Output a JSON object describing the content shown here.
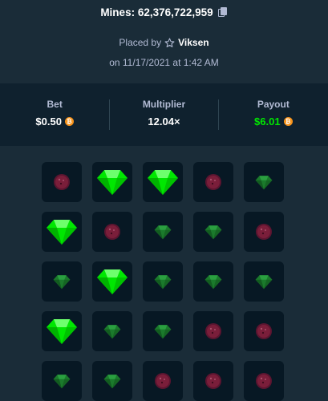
{
  "header": {
    "mines_label": "Mines: 62,376,722,959",
    "placed_by_prefix": "Placed by",
    "username": "Viksen",
    "date_line": "on 11/17/2021 at 1:42 AM"
  },
  "stats": [
    {
      "label": "Bet",
      "value": "$0.50",
      "currency_icon": "bitcoin-icon",
      "color": "#ffffff"
    },
    {
      "label": "Multiplier",
      "value": "12.04×",
      "currency_icon": "",
      "color": "#ffffff"
    },
    {
      "label": "Payout",
      "value": "$6.01",
      "currency_icon": "bitcoin-icon",
      "color": "#00e701"
    }
  ],
  "colors": {
    "background": "#1a2c38",
    "stats_background": "#0f212e",
    "tile": "#071824",
    "gem_revealed": "#00e701",
    "gem_unrevealed": "#1b7a2c",
    "mine": "#7a1e3a",
    "muted_text": "#b1bad3"
  },
  "board": {
    "rows": [
      [
        "mine",
        "gem-picked",
        "gem-picked",
        "mine",
        "gem"
      ],
      [
        "gem-picked",
        "mine",
        "gem",
        "gem",
        "mine"
      ],
      [
        "gem",
        "gem-picked",
        "gem",
        "gem",
        "gem"
      ],
      [
        "gem-picked",
        "gem",
        "gem",
        "mine",
        "mine"
      ],
      [
        "gem",
        "gem",
        "mine",
        "mine",
        "mine"
      ]
    ]
  }
}
